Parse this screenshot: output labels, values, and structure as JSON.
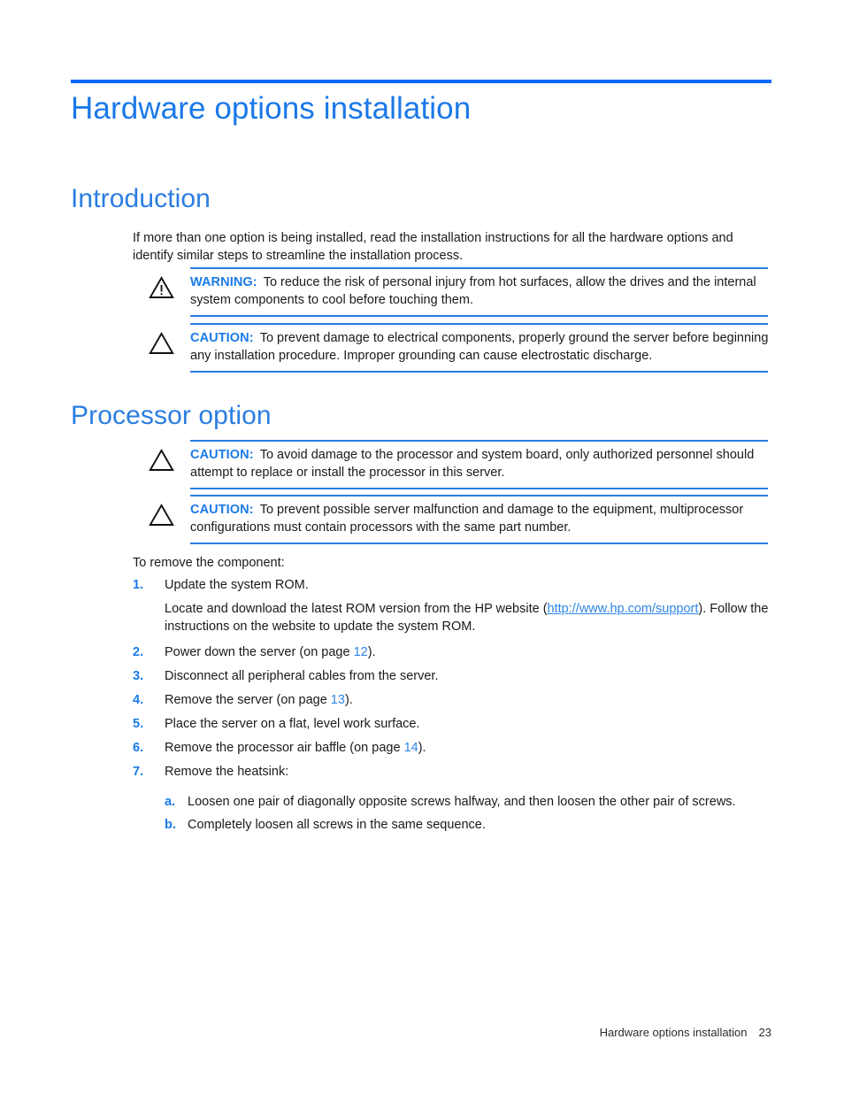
{
  "document": {
    "chapter_title": "Hardware options installation",
    "accent_color": "#0066ff",
    "heading_color": "#2a7de1",
    "link_color": "#2f86e8"
  },
  "sections": {
    "introduction": {
      "title": "Introduction",
      "paragraph": "If more than one option is being installed, read the installation instructions for all the hardware options and identify similar steps to streamline the installation process.",
      "alerts": [
        {
          "type": "warning",
          "icon": "warning-triangle-icon",
          "label": "WARNING:",
          "text": "To reduce the risk of personal injury from hot surfaces, allow the drives and the internal system components to cool before touching them."
        },
        {
          "type": "caution",
          "icon": "caution-triangle-icon",
          "label": "CAUTION:",
          "text": "To prevent damage to electrical components, properly ground the server before beginning any installation procedure. Improper grounding can cause electrostatic discharge."
        }
      ]
    },
    "processor_option": {
      "title": "Processor option",
      "alerts": [
        {
          "type": "caution",
          "icon": "caution-triangle-icon",
          "label": "CAUTION:",
          "text": "To avoid damage to the processor and system board, only authorized personnel should attempt to replace or install the processor in this server."
        },
        {
          "type": "caution",
          "icon": "caution-triangle-icon",
          "label": "CAUTION:",
          "text": "To prevent possible server malfunction and damage to the equipment, multiprocessor configurations must contain processors with the same part number."
        }
      ],
      "procedure_intro": "To remove the component:",
      "steps": [
        {
          "num": "1.",
          "text": "Update the system ROM.",
          "detail_before_link": "Locate and download the latest ROM version from the HP website (",
          "detail_link": "http://www.hp.com/support",
          "detail_after_link": "). Follow the instructions on the website to update the system ROM."
        },
        {
          "num": "2.",
          "text_before_ref": "Power down the server (on page ",
          "page_ref": "12",
          "text_after_ref": ")."
        },
        {
          "num": "3.",
          "text": "Disconnect all peripheral cables from the server."
        },
        {
          "num": "4.",
          "text_before_ref": "Remove the server (on page ",
          "page_ref": "13",
          "text_after_ref": ")."
        },
        {
          "num": "5.",
          "text": "Place the server on a flat, level work surface."
        },
        {
          "num": "6.",
          "text_before_ref": "Remove the processor air baffle (on page ",
          "page_ref": "14",
          "text_after_ref": ")."
        },
        {
          "num": "7.",
          "text": "Remove the heatsink:",
          "substeps": [
            {
              "num": "a.",
              "text": "Loosen one pair of diagonally opposite screws halfway, and then loosen the other pair of screws."
            },
            {
              "num": "b.",
              "text": "Completely loosen all screws in the same sequence."
            }
          ]
        }
      ]
    }
  },
  "footer": {
    "text": "Hardware options installation",
    "page_number": "23"
  }
}
